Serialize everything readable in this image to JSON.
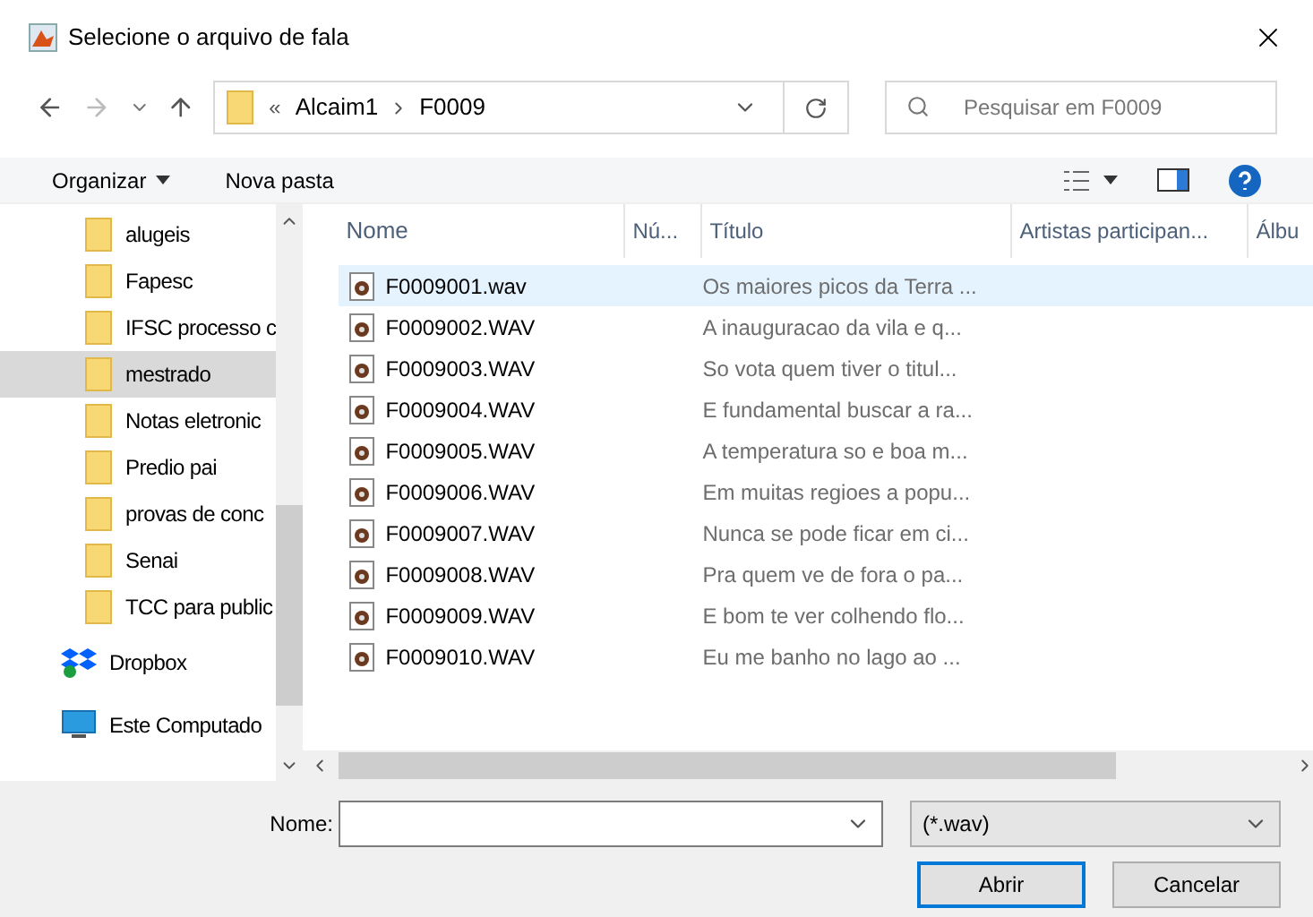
{
  "window": {
    "title": "Selecione o arquivo de fala"
  },
  "address": {
    "prefix": "«",
    "crumbs": [
      "Alcaim1",
      "F0009"
    ]
  },
  "search": {
    "placeholder": "Pesquisar em F0009"
  },
  "toolbar": {
    "organize": "Organizar",
    "new_folder": "Nova pasta"
  },
  "sidebar": {
    "items": [
      {
        "label": "alugeis",
        "kind": "folder",
        "selected": false
      },
      {
        "label": "Fapesc",
        "kind": "folder",
        "selected": false
      },
      {
        "label": "IFSC processo c",
        "kind": "folder",
        "selected": false
      },
      {
        "label": "mestrado",
        "kind": "folder",
        "selected": true
      },
      {
        "label": "Notas eletronic",
        "kind": "folder",
        "selected": false
      },
      {
        "label": "Predio pai",
        "kind": "folder",
        "selected": false
      },
      {
        "label": "provas de conc",
        "kind": "folder",
        "selected": false
      },
      {
        "label": "Senai",
        "kind": "folder",
        "selected": false
      },
      {
        "label": "TCC para public",
        "kind": "folder",
        "selected": false
      },
      {
        "label": "Dropbox",
        "kind": "dropbox",
        "selected": false
      },
      {
        "label": "Este Computado",
        "kind": "computer",
        "selected": false
      }
    ]
  },
  "table": {
    "columns": [
      "Nome",
      "Nú...",
      "Título",
      "Artistas participan...",
      "Álbu"
    ],
    "rows": [
      {
        "name": "F0009001.wav",
        "title": "Os maiores picos da Terra ...",
        "selected": true
      },
      {
        "name": "F0009002.WAV",
        "title": "A inauguracao da vila e q...",
        "selected": false
      },
      {
        "name": "F0009003.WAV",
        "title": "So vota quem tiver o titul...",
        "selected": false
      },
      {
        "name": "F0009004.WAV",
        "title": "E fundamental buscar a ra...",
        "selected": false
      },
      {
        "name": "F0009005.WAV",
        "title": "A temperatura so e boa m...",
        "selected": false
      },
      {
        "name": "F0009006.WAV",
        "title": "Em muitas regioes a popu...",
        "selected": false
      },
      {
        "name": "F0009007.WAV",
        "title": "Nunca se pode ficar em ci...",
        "selected": false
      },
      {
        "name": "F0009008.WAV",
        "title": "Pra quem ve de fora o pa...",
        "selected": false
      },
      {
        "name": "F0009009.WAV",
        "title": "E bom te ver colhendo flo...",
        "selected": false
      },
      {
        "name": "F0009010.WAV",
        "title": "Eu me banho no lago ao ...",
        "selected": false
      }
    ]
  },
  "footer": {
    "name_label": "Nome:",
    "file_type": "(*.wav)",
    "open": "Abrir",
    "cancel": "Cancelar"
  }
}
